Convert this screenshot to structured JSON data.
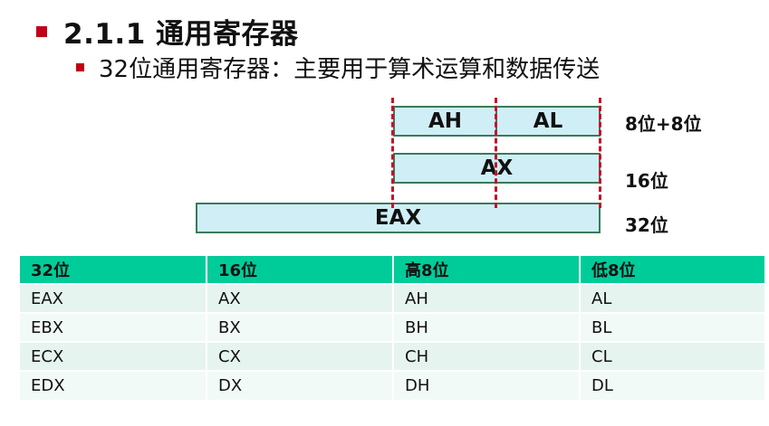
{
  "heading": "2.1.1 通用寄存器",
  "subheading": "32位通用寄存器：主要用于算术运算和数据传送",
  "diagram": {
    "ah": "AH",
    "al": "AL",
    "ax": "AX",
    "eax": "EAX",
    "label_8": "8位+8位",
    "label_16": "16位",
    "label_32": "32位"
  },
  "colors": {
    "accent_red": "#c0001a",
    "register_fill": "#cfeef5",
    "table_header": "#00cc99"
  },
  "table": {
    "headers": [
      "32位",
      "16位",
      "高8位",
      "低8位"
    ],
    "rows": [
      [
        "EAX",
        "AX",
        "AH",
        "AL"
      ],
      [
        "EBX",
        "BX",
        "BH",
        "BL"
      ],
      [
        "ECX",
        "CX",
        "CH",
        "CL"
      ],
      [
        "EDX",
        "DX",
        "DH",
        "DL"
      ]
    ]
  }
}
